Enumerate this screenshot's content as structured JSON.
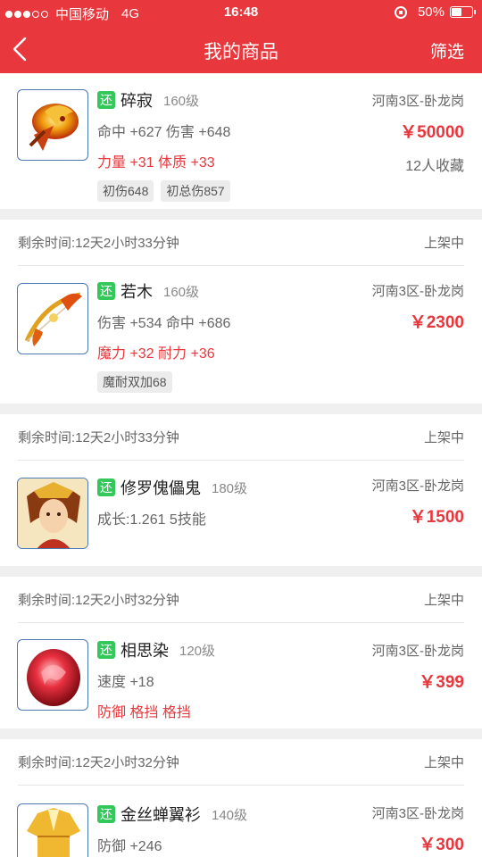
{
  "status_bar": {
    "carrier": "中国移动",
    "network": "4G",
    "time": "16:48",
    "battery_text": "50%",
    "battery_level": 0.5,
    "signal_bars": 3
  },
  "navbar": {
    "title": "我的商品",
    "filter_label": "筛选"
  },
  "items": [
    {
      "badge": "还",
      "name": "碎寂",
      "level": "160级",
      "stats": "命中 +627 伤害 +648",
      "red_stats": "力量 +31 体质 +33",
      "tags": [
        "初伤648",
        "初总伤857"
      ],
      "server": "河南3区-卧龙岗",
      "price": "￥50000",
      "favorites": "12人收藏",
      "icon": "dragon-fan-icon"
    },
    {
      "remaining": "剩余时间:12天2小时33分钟",
      "status": "上架中",
      "badge": "还",
      "name": "若木",
      "level": "160级",
      "stats": "伤害 +534 命中 +686",
      "red_stats": "魔力 +32 耐力 +36",
      "tags": [
        "魔耐双加68"
      ],
      "server": "河南3区-卧龙岗",
      "price": "￥2300",
      "icon": "golden-bow-icon"
    },
    {
      "remaining": "剩余时间:12天2小时33分钟",
      "status": "上架中",
      "badge": "还",
      "name": "修罗傀儡鬼",
      "level": "180级",
      "stats": "成长:1.261 5技能",
      "server": "河南3区-卧龙岗",
      "price": "￥1500",
      "icon": "demon-portrait-icon"
    },
    {
      "remaining": "剩余时间:12天2小时32分钟",
      "status": "上架中",
      "badge": "还",
      "name": "相思染",
      "level": "120级",
      "stats": "速度 +18",
      "red_stats": "防御 格挡 格挡",
      "server": "河南3区-卧龙岗",
      "price": "￥399",
      "icon": "red-jade-icon"
    },
    {
      "remaining": "剩余时间:12天2小时32分钟",
      "status": "上架中",
      "badge": "还",
      "name": "金丝蝉翼衫",
      "level": "140级",
      "stats": "防御 +246",
      "server": "河南3区-卧龙岗",
      "price": "￥300",
      "icon": "golden-robe-icon"
    }
  ]
}
